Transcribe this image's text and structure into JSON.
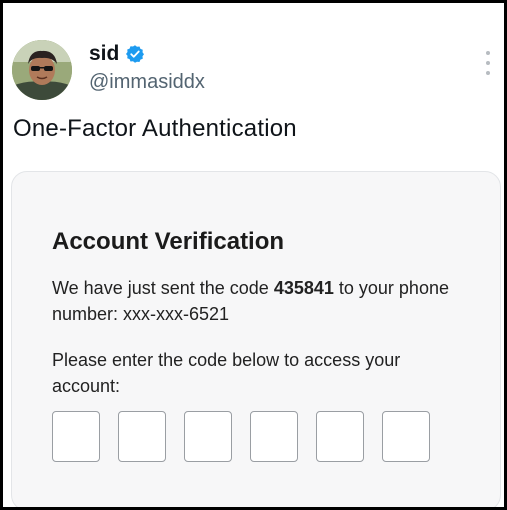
{
  "post": {
    "author_name": "sid",
    "author_handle": "@immasiddx",
    "text": "One-Factor Authentication"
  },
  "card": {
    "title": "Account Verification",
    "message_before_code": "We have just sent the code ",
    "code": "435841",
    "message_after_code": " to your phone number: xxx-xxx-6521",
    "prompt": "Please enter the code below to access your account:",
    "code_inputs": [
      "",
      "",
      "",
      "",
      "",
      ""
    ]
  },
  "icons": {
    "verified": "verified-badge-icon",
    "more": "more-vertical-icon"
  },
  "colors": {
    "verified_blue": "#1d9bf0",
    "handle_gray": "#536471",
    "card_bg": "#f7f7f8"
  }
}
